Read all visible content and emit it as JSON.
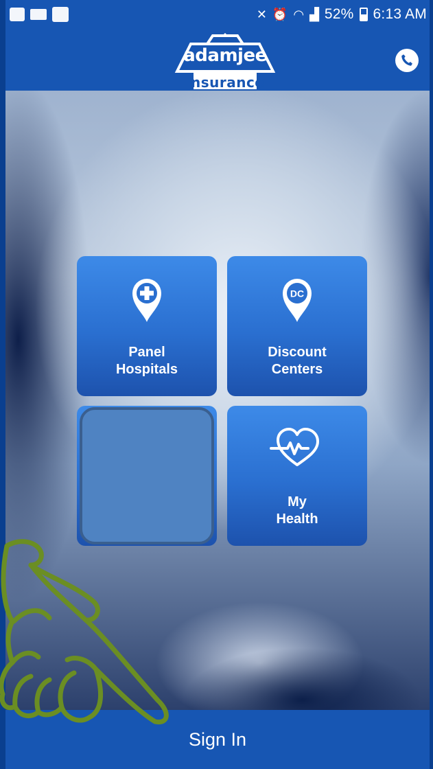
{
  "status_bar": {
    "battery_percent": "52%",
    "time": "6:13 AM",
    "left_icons": [
      "gallery-icon",
      "video-icon",
      "translate-icon"
    ],
    "right_icons": [
      "mute-icon",
      "alarm-icon",
      "wifi-icon",
      "sim-icon",
      "signal-icon",
      "battery-icon"
    ]
  },
  "header": {
    "logo_main": "adamjee",
    "logo_sub": "insurance",
    "call_icon": "phone-icon"
  },
  "tiles": [
    {
      "line1": "Panel",
      "line2": "Hospitals",
      "icon": "hospital-pin-icon"
    },
    {
      "line1": "Discount",
      "line2": "Centers",
      "icon": "dc-pin-icon"
    },
    {
      "line1": "",
      "line2": "",
      "icon": ""
    },
    {
      "line1": "My",
      "line2": "Health",
      "icon": "heartbeat-icon"
    }
  ],
  "footer": {
    "signin_label": "Sign In"
  },
  "colors": {
    "brand_blue": "#1756b3",
    "tile_blue": "#2a6fd0",
    "hand_green": "#6b8e23"
  }
}
